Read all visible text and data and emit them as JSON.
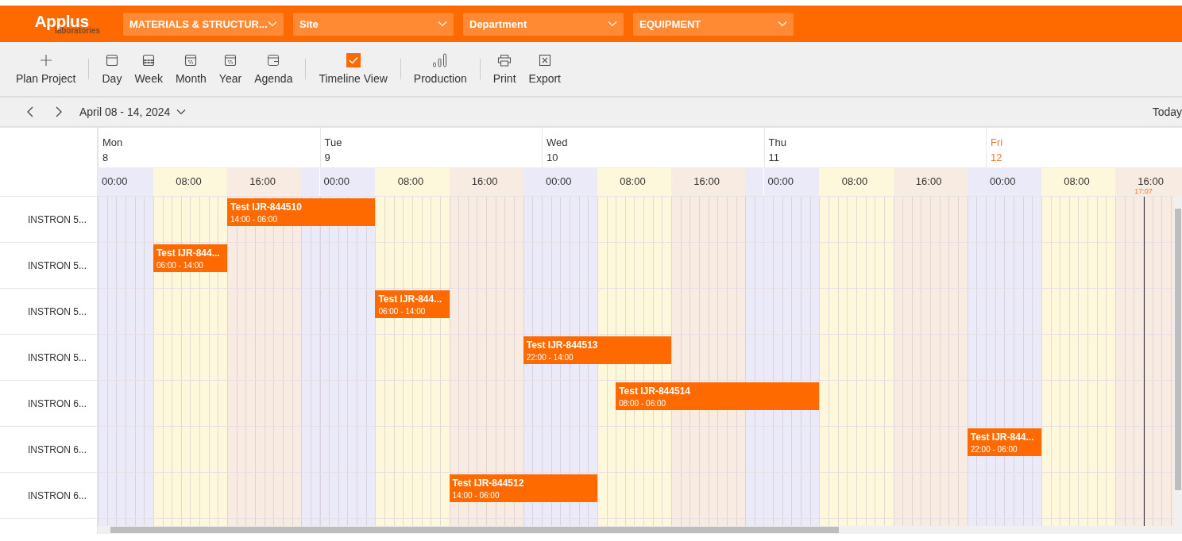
{
  "logo": {
    "name": "Applus",
    "sub": "laboratories"
  },
  "filters": [
    {
      "label": "MATERIALS & STRUCTUR..."
    },
    {
      "label": "Site"
    },
    {
      "label": "Department"
    },
    {
      "label": "EQUIPMENT"
    }
  ],
  "toolbar": {
    "groups": [
      [
        {
          "kind": "plus",
          "label": "Plan Project"
        }
      ],
      [
        {
          "kind": "day",
          "label": "Day"
        },
        {
          "kind": "week",
          "label": "Week"
        },
        {
          "kind": "month",
          "label": "Month"
        },
        {
          "kind": "year",
          "label": "Year"
        },
        {
          "kind": "agenda",
          "label": "Agenda"
        }
      ],
      [
        {
          "kind": "checkbox",
          "label": "Timeline View",
          "checked": true
        }
      ],
      [
        {
          "kind": "chart",
          "label": "Production"
        }
      ],
      [
        {
          "kind": "print",
          "label": "Print"
        },
        {
          "kind": "export",
          "label": "Export"
        }
      ]
    ]
  },
  "date_range": "April 08 - 14, 2024",
  "today_button": "Today",
  "days": [
    {
      "weekday": "Mon",
      "date": "8",
      "today": false,
      "hours": [
        "00:00",
        "08:00",
        "16:00"
      ]
    },
    {
      "weekday": "Tue",
      "date": "9",
      "today": false,
      "hours": [
        "00:00",
        "08:00",
        "16:00"
      ]
    },
    {
      "weekday": "Wed",
      "date": "10",
      "today": false,
      "hours": [
        "00:00",
        "08:00",
        "16:00"
      ]
    },
    {
      "weekday": "Thu",
      "date": "11",
      "today": false,
      "hours": [
        "00:00",
        "08:00",
        "16:00"
      ]
    },
    {
      "weekday": "Fri",
      "date": "12",
      "today": true,
      "hours": [
        "00:00",
        "08:00",
        "16:00"
      ]
    }
  ],
  "now_marker": {
    "time": "17:07"
  },
  "rows": [
    {
      "name": "INSTRON 5...",
      "cells": [
        {
          "event": {
            "title": "Test IJR-844510",
            "time": "14:00 - 06:00"
          }
        },
        {},
        {},
        {},
        {}
      ]
    },
    {
      "name": "INSTRON 5...",
      "cells": [
        {
          "event": {
            "title": "Test IJR-844...",
            "time": "06:00 - 14:00"
          }
        },
        {},
        {},
        {},
        {}
      ]
    },
    {
      "name": "INSTRON 5...",
      "cells": [
        {},
        {
          "event": {
            "title": "Test IJR-844...",
            "time": "06:00 - 14:00"
          }
        },
        {},
        {},
        {}
      ]
    },
    {
      "name": "INSTRON 5...",
      "cells": [
        {},
        {
          "event": {
            "title": "Test IJR-844513",
            "time": "22:00 - 14:00"
          }
        },
        {},
        {},
        {}
      ]
    },
    {
      "name": "INSTRON 6...",
      "cells": [
        {},
        {},
        {
          "event": {
            "title": "Test IJR-844514",
            "time": "08:00 - 06:00"
          }
        },
        {},
        {}
      ]
    },
    {
      "name": "INSTRON 6...",
      "cells": [
        {},
        {},
        {},
        {
          "event": {
            "title": "Test IJR-844...",
            "time": "22:00 - 06:00"
          }
        },
        {}
      ]
    },
    {
      "name": "INSTRON 6...",
      "cells": [
        {},
        {
          "event": {
            "title": "Test IJR-844512",
            "time": "14:00 - 06:00"
          }
        },
        {},
        {},
        {}
      ]
    }
  ]
}
